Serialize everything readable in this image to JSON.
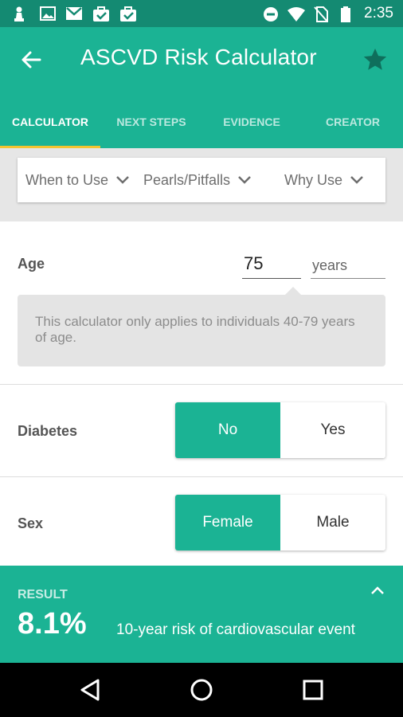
{
  "status_bar": {
    "time": "2:35",
    "left_icons": [
      "pawn-notification-icon",
      "image-icon",
      "gmail-icon",
      "clipboard-check-icon",
      "briefcase-check-icon"
    ],
    "right_icons": [
      "do-not-disturb-icon",
      "wifi-icon",
      "no-sim-icon",
      "battery-icon"
    ]
  },
  "app_bar": {
    "title": "ASCVD Risk Calculator",
    "accent_color": "#1bb394"
  },
  "tabs": [
    {
      "label": "CALCULATOR",
      "active": true
    },
    {
      "label": "NEXT STEPS",
      "active": false
    },
    {
      "label": "EVIDENCE",
      "active": false
    },
    {
      "label": "CREATOR",
      "active": false
    }
  ],
  "info_links": [
    {
      "label": "When to Use"
    },
    {
      "label": "Pearls/Pitfalls"
    },
    {
      "label": "Why Use"
    }
  ],
  "age": {
    "label": "Age",
    "value": "75",
    "units": "years",
    "warning": "This calculator only applies to individuals 40-79 years of age."
  },
  "diabetes": {
    "label": "Diabetes",
    "options": [
      "No",
      "Yes"
    ],
    "selected": "No"
  },
  "sex": {
    "label": "Sex",
    "options": [
      "Female",
      "Male"
    ],
    "selected": "Female"
  },
  "result": {
    "label": "RESULT",
    "value": "8.1%",
    "description": "10-year risk of cardiovascular event"
  }
}
